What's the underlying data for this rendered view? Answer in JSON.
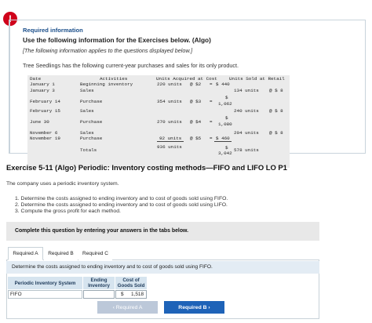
{
  "alert": {
    "glyph": "!"
  },
  "info": {
    "title": "Required information",
    "heading": "Use the following information for the Exercises below. (Algo)",
    "applies": "[The following information applies to the questions displayed below.]",
    "intro": "Tree Seedlings has the following current-year purchases and sales for its only product."
  },
  "inventory_table": {
    "headers": {
      "date": "Date",
      "activities": "Activities",
      "acquired": "Units Acquired at Cost",
      "sold": "Units Sold at Retail"
    },
    "rows": [
      {
        "date": "January 1",
        "activity": "Beginning inventory",
        "units": "220 units",
        "at": "@ $2",
        "eq": "=",
        "cost": "$ 440",
        "sold_units": "",
        "retail": ""
      },
      {
        "date": "January 3",
        "activity": "Sales",
        "units": "",
        "at": "",
        "eq": "",
        "cost": "",
        "sold_units": "134 units",
        "retail": "@ $ 8"
      },
      {
        "date": "February 14",
        "activity": "Purchase",
        "units": "354 units",
        "at": "@ $3",
        "eq": "=",
        "cost_prefix": "$",
        "cost": "1,062",
        "sold_units": "",
        "retail": ""
      },
      {
        "date": "February 15",
        "activity": "Sales",
        "units": "",
        "at": "",
        "eq": "",
        "cost": "",
        "sold_units": "240 units",
        "retail": "@ $ 8"
      },
      {
        "date": "June 30",
        "activity": "Purchase",
        "units": "270 units",
        "at": "@ $4",
        "eq": "=",
        "cost_prefix": "$",
        "cost": "1,080",
        "sold_units": "",
        "retail": ""
      },
      {
        "date": "November 6",
        "activity": "Sales",
        "units": "",
        "at": "",
        "eq": "",
        "cost": "",
        "sold_units": "204 units",
        "retail": "@ $ 8"
      },
      {
        "date": "November 19",
        "activity": "Purchase",
        "units": "92 units",
        "at": "@ $5",
        "eq": "=",
        "cost": "$ 460",
        "sold_units": "",
        "retail": ""
      },
      {
        "date": "",
        "activity": "Totals",
        "units": "936 units",
        "at": "",
        "eq": "",
        "cost_prefix": "$",
        "cost": "3,042",
        "sold_units": "578 units",
        "retail": ""
      }
    ]
  },
  "exercise": {
    "title": "Exercise 5-11 (Algo) Periodic: Inventory costing methods—FIFO and LIFO LO P1",
    "company": "The company uses a periodic inventory system.",
    "tasks": [
      "1. Determine the costs assigned to ending inventory and to cost of goods sold using FIFO.",
      "2. Determine the costs assigned to ending inventory and to cost of goods sold using LIFO.",
      "3. Compute the gross profit for each method."
    ]
  },
  "instruction_bar": "Complete this question by entering your answers in the tabs below.",
  "tabs": [
    "Required A",
    "Required B",
    "Required C"
  ],
  "active_tab": "Required A",
  "panel": {
    "prompt": "Determine the costs assigned to ending inventory and to cost of goods sold using FIFO.",
    "headers": {
      "system": "Periodic Inventory System",
      "ending": "Ending Inventory",
      "cogs": "Cost of Goods Sold"
    },
    "row": {
      "label": "FIFO",
      "ending_value": "",
      "cogs_prefix": "$",
      "cogs_value": "1,518"
    }
  },
  "nav": {
    "prev": "‹  Required A",
    "next": "Required B  ›"
  },
  "colors": {
    "accent": "#1e63b8",
    "alert": "#d0021b",
    "header_bg": "#d6e4ef"
  }
}
